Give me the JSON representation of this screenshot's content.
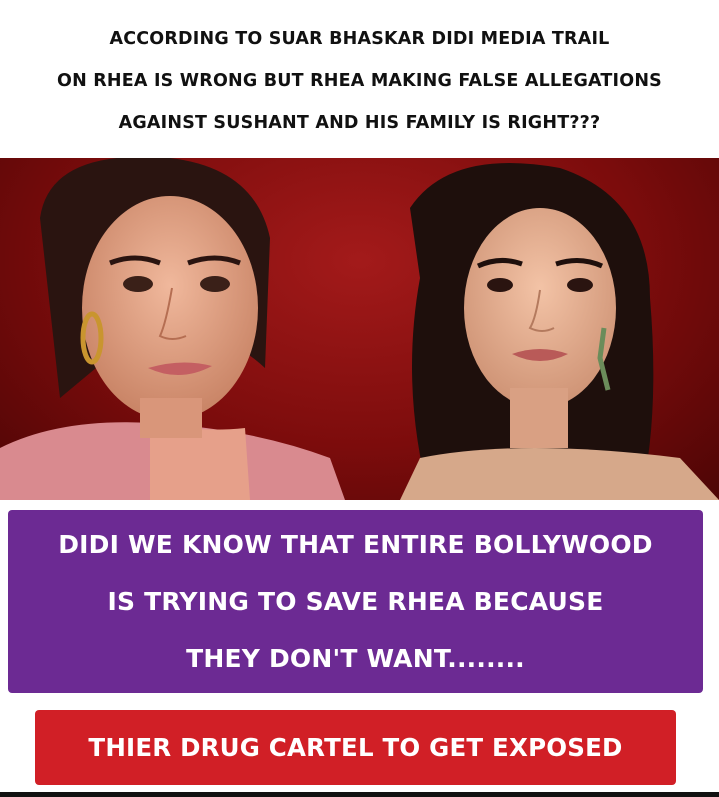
{
  "headline": {
    "lines": [
      "ACCORDING TO SUAR BHASKAR DIDI MEDIA TRAIL",
      "ON RHEA IS WRONG BUT RHEA MAKING FALSE ALLEGATIONS",
      "AGAINST SUSHANT AND HIS FAMILY IS RIGHT???"
    ]
  },
  "purple_box": {
    "lines": [
      "DIDI WE KNOW THAT ENTIRE BOLLYWOOD",
      "IS TRYING TO SAVE RHEA BECAUSE",
      "THEY DON'T WANT........"
    ],
    "color": "#6c2a93"
  },
  "red_box": {
    "text": "THIER DRUG CARTEL TO GET EXPOSED",
    "color": "#d11f26"
  },
  "colors": {
    "photo_background": "#8b1010",
    "text_dark": "#111111",
    "text_light": "#ffffff"
  }
}
